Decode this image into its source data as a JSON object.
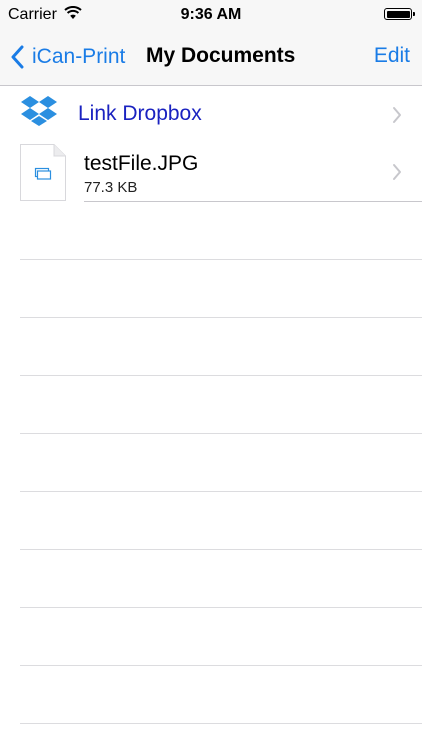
{
  "status_bar": {
    "carrier": "Carrier",
    "time": "9:36 AM",
    "wifi_icon": "wifi-icon",
    "battery_icon": "battery-icon"
  },
  "nav": {
    "back_label": "iCan-Print",
    "title": "My Documents",
    "edit_label": "Edit"
  },
  "dropbox_row": {
    "label": "Link Dropbox",
    "icon": "dropbox-icon"
  },
  "files": [
    {
      "name": "testFile.JPG",
      "size": "77.3 KB",
      "icon": "document-icon"
    }
  ],
  "colors": {
    "accent": "#1a7ce6",
    "dropbox_link": "#1a22c0",
    "dropbox_brand": "#2b8fe0",
    "separator": "#c8c7cc"
  }
}
